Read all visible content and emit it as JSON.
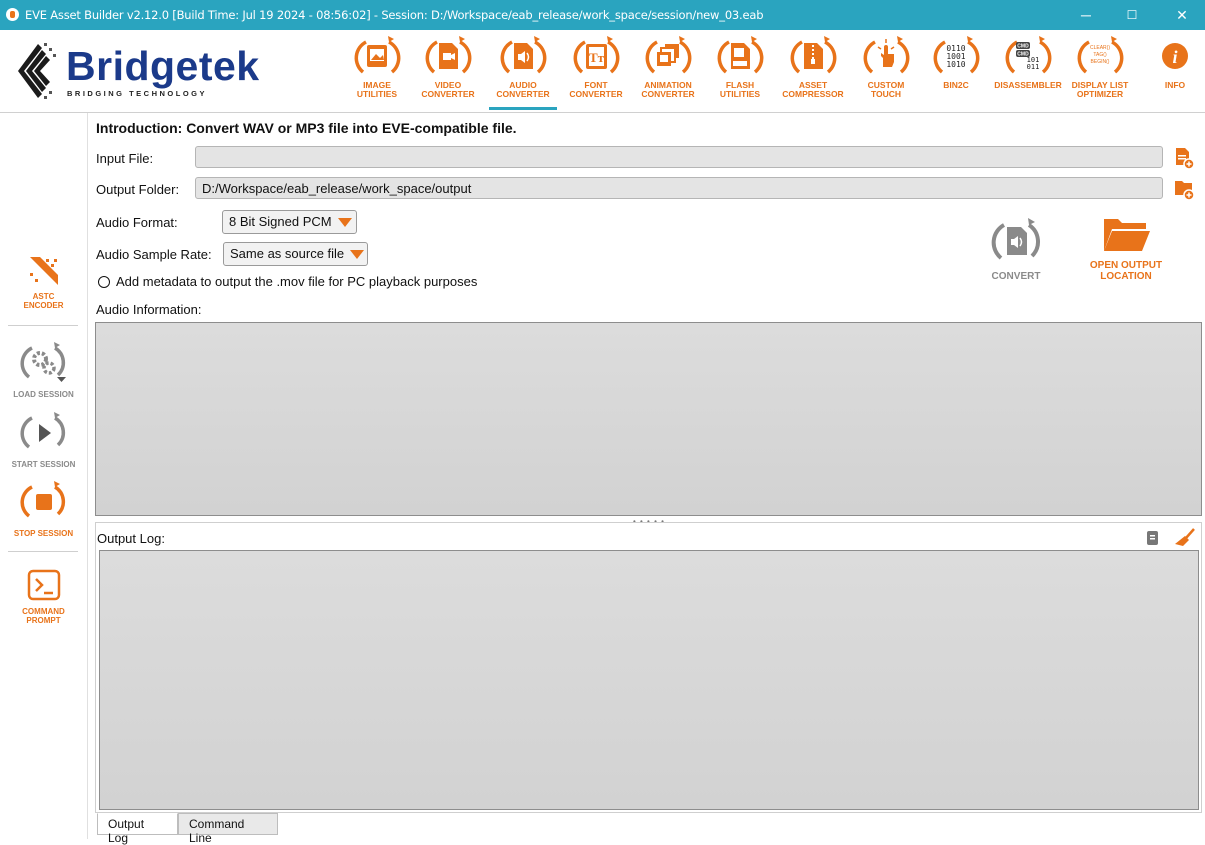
{
  "window": {
    "title": "EVE Asset Builder v2.12.0 [Build Time: Jul 19 2024 - 08:56:02] - Session: D:/Workspace/eab_release/work_space/session/new_03.eab",
    "minimize": "─",
    "maximize": "☐",
    "close": "✕"
  },
  "logo": {
    "name": "Bridgetek",
    "tagline": "BRIDGING     TECHNOLOGY"
  },
  "toolbar": {
    "items": [
      {
        "label_1": "IMAGE",
        "label_2": "UTILITIES",
        "icon": "image-icon"
      },
      {
        "label_1": "VIDEO",
        "label_2": "CONVERTER",
        "icon": "video-icon"
      },
      {
        "label_1": "AUDIO",
        "label_2": "CONVERTER",
        "icon": "audio-icon",
        "active": true
      },
      {
        "label_1": "FONT",
        "label_2": "CONVERTER",
        "icon": "font-icon"
      },
      {
        "label_1": "ANIMATION",
        "label_2": "CONVERTER",
        "icon": "animation-icon"
      },
      {
        "label_1": "FLASH",
        "label_2": "UTILITIES",
        "icon": "flash-icon"
      },
      {
        "label_1": "ASSET",
        "label_2": "COMPRESSOR",
        "icon": "compress-icon"
      },
      {
        "label_1": "CUSTOM",
        "label_2": "TOUCH",
        "icon": "touch-icon"
      },
      {
        "label_1": "BIN2C",
        "label_2": "",
        "icon": "binary-icon"
      },
      {
        "label_1": "DISASSEMBLER",
        "label_2": "",
        "icon": "disassembler-icon"
      },
      {
        "label_1": "DISPLAY LIST",
        "label_2": "OPTIMIZER",
        "icon": "optimizer-icon"
      },
      {
        "label_1": "INFO",
        "label_2": "",
        "icon": "info-icon"
      }
    ],
    "bin_text": [
      "0110",
      "1001",
      "1010"
    ],
    "cmd_text": [
      "CMD",
      "CMD",
      "101",
      "011"
    ],
    "opt_text": [
      "CLEAR()",
      "TAG()",
      "BEGIN()"
    ]
  },
  "rail": {
    "astc_1": "ASTC",
    "astc_2": "ENCODER",
    "load": "LOAD SESSION",
    "start": "START SESSION",
    "stop": "STOP SESSION",
    "cmd_1": "COMMAND",
    "cmd_2": "PROMPT"
  },
  "main": {
    "heading": "Introduction: Convert WAV or MP3 file into EVE-compatible file.",
    "input_label": "Input File:",
    "input_value": "",
    "output_label": "Output Folder:",
    "output_value": "D:/Workspace/eab_release/work_space/output",
    "format_label": "Audio Format:",
    "format_value": "8 Bit Signed PCM",
    "rate_label": "Audio Sample Rate:",
    "rate_value": "Same as source file",
    "metadata_label": "Add metadata to output the .mov file for PC playback purposes",
    "convert_label": "CONVERT",
    "open_label_1": "OPEN OUTPUT",
    "open_label_2": "LOCATION",
    "audio_info_label": "Audio Information:",
    "splitter_handle": "• • • • •",
    "output_log_label": "Output Log:",
    "tab_output_log": "Output Log",
    "tab_command_line": "Command Line"
  },
  "colors": {
    "accent": "#e8731a",
    "titlebar": "#2aa4bf",
    "brand": "#1b3a8a",
    "gray_icon": "#8a8a8a"
  }
}
